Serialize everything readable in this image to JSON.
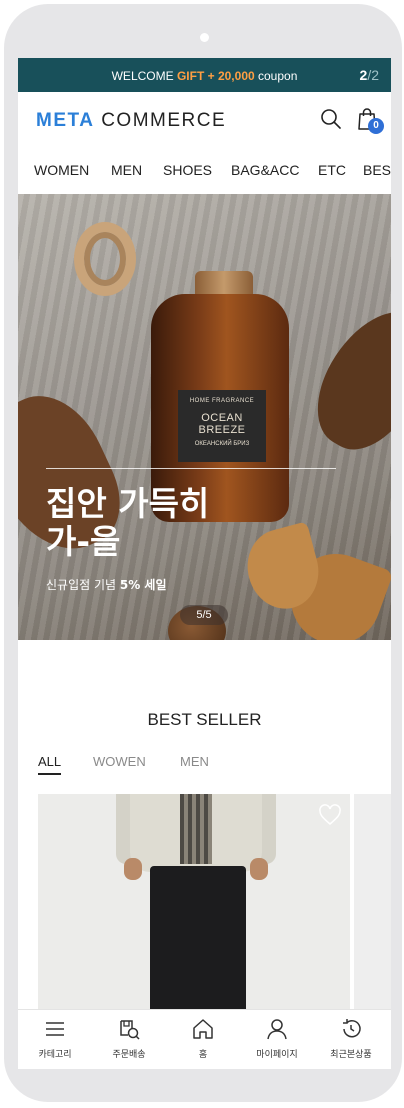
{
  "promo": {
    "prefix": "WELCOME ",
    "gift": "GIFT + 20,000",
    "suffix": " coupon",
    "current": "2",
    "separator": "/",
    "total": "2"
  },
  "header": {
    "logo_accent": "META",
    "logo_rest": " COMMERCE",
    "cart_count": "0",
    "search_icon": "search-icon",
    "cart_icon": "shopping-bag-icon"
  },
  "nav": [
    "WOMEN",
    "MEN",
    "SHOES",
    "BAG&ACC",
    "ETC",
    "BEST"
  ],
  "hero": {
    "bottle_label": [
      "HOME FRAGRANCE",
      "OCEAN BREEZE",
      "ОКЕАНСКИЙ БРИЗ"
    ],
    "title_line1": "집안 가득히",
    "title_line2": "가-을",
    "subtitle_prefix": "신규입점 기념 ",
    "subtitle_bold": "5% 세일",
    "pager_current": "5",
    "pager_sep": "/",
    "pager_total": "5"
  },
  "best_seller": {
    "title": "BEST SELLER",
    "tabs": [
      "ALL",
      "WOWEN",
      "MEN"
    ],
    "active_tab": "ALL"
  },
  "tabbar": [
    {
      "label": "카테고리",
      "icon": "menu-icon"
    },
    {
      "label": "주문배송",
      "icon": "delivery-icon"
    },
    {
      "label": "홈",
      "icon": "home-icon"
    },
    {
      "label": "마이페이지",
      "icon": "user-icon"
    },
    {
      "label": "최근본상품",
      "icon": "history-icon"
    }
  ],
  "colors": {
    "promo_bg": "#18505a",
    "gift_accent": "#ff9f43",
    "logo_accent": "#2b7fd8",
    "badge": "#2f6fd6"
  }
}
